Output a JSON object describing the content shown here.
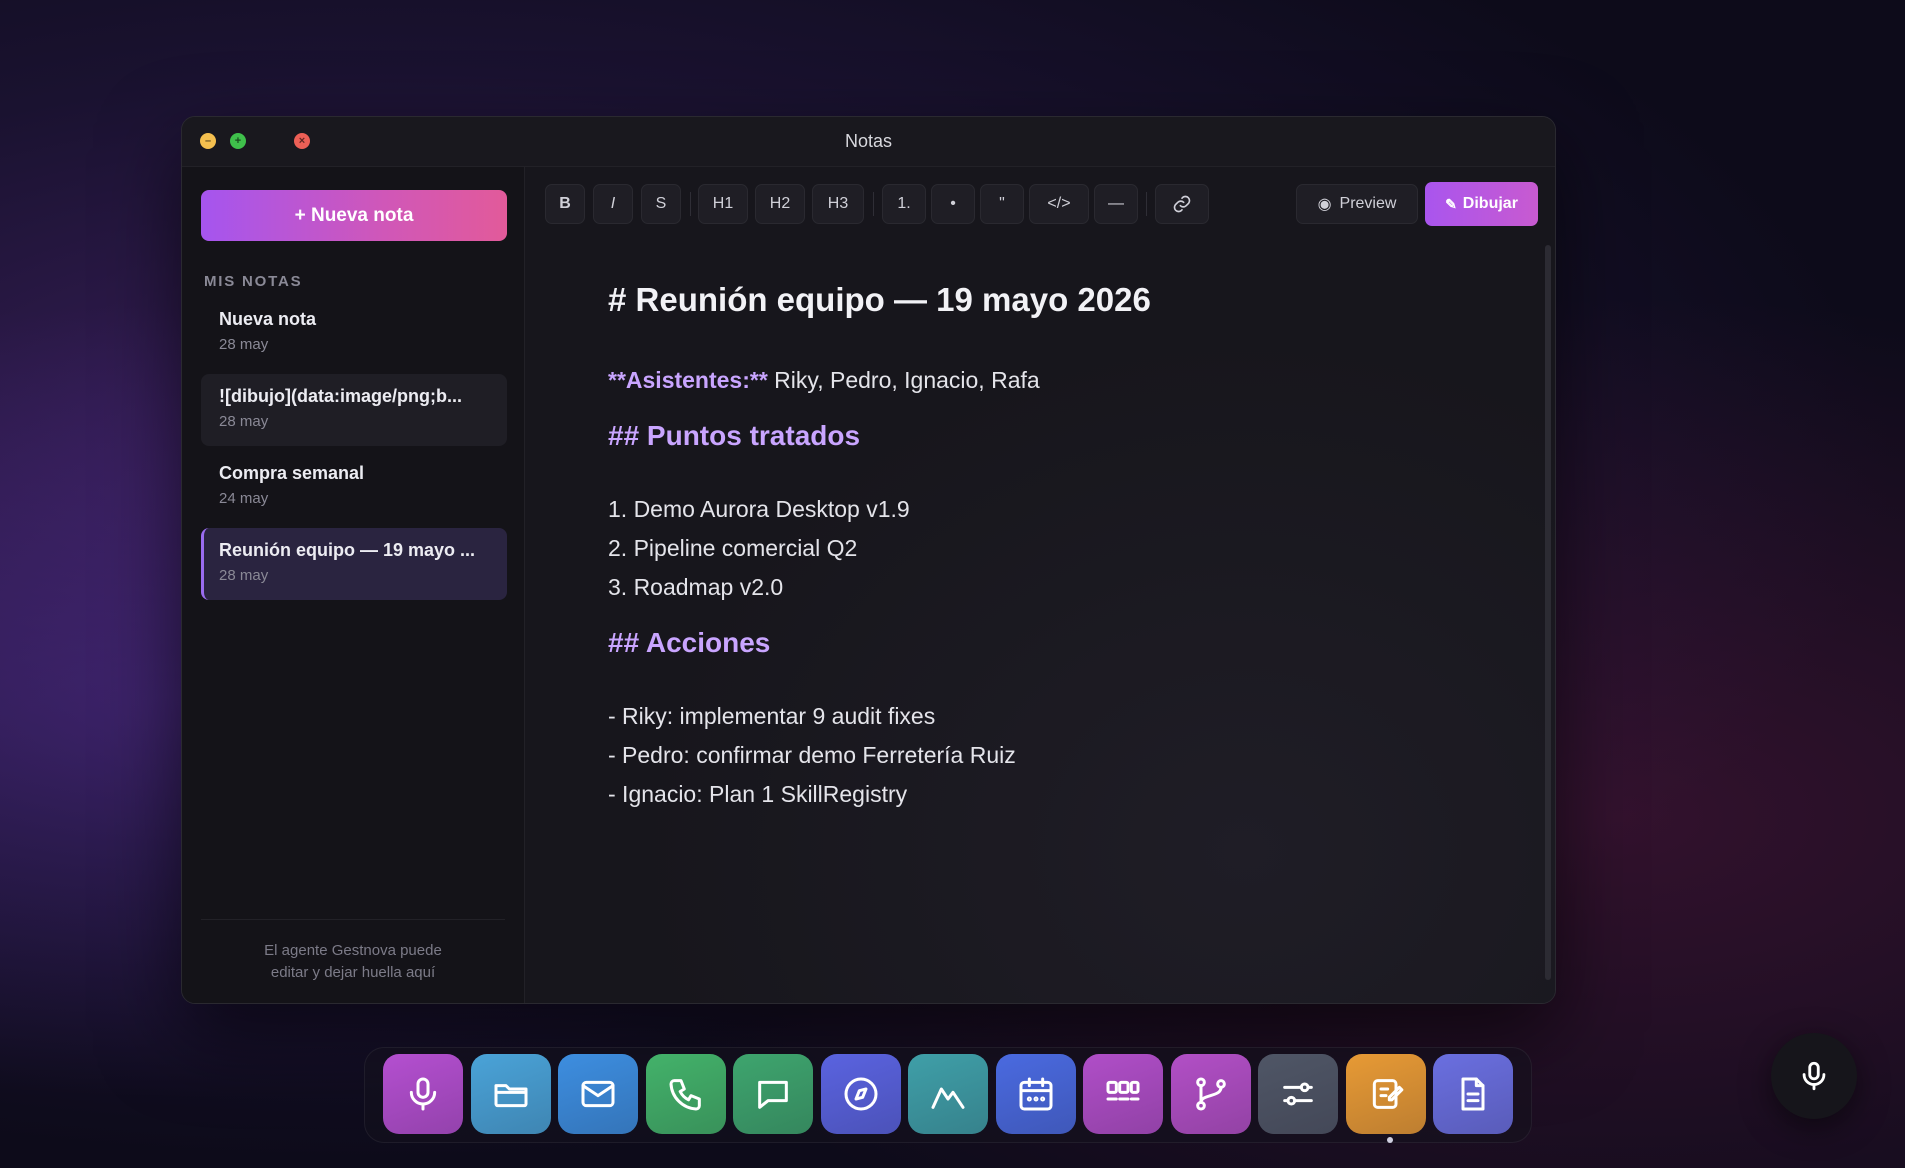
{
  "window": {
    "title": "Notas"
  },
  "sidebar": {
    "new_note_label": "+ Nueva nota",
    "section_label": "MIS NOTAS",
    "notes": [
      {
        "title": "Nueva nota",
        "date": "28 may"
      },
      {
        "title": "![dibujo](data:image/png;b...",
        "date": "28 may"
      },
      {
        "title": "Compra semanal",
        "date": "24 may"
      },
      {
        "title": "Reunión equipo — 19 mayo ...",
        "date": "28 may"
      }
    ],
    "footer_line1": "El agente Gestnova puede",
    "footer_line2": "editar y dejar huella aquí"
  },
  "toolbar": {
    "bold": "B",
    "italic": "I",
    "strike": "S",
    "h1": "H1",
    "h2": "H2",
    "h3": "H3",
    "ordered_list": "1.",
    "bullet_list": "•",
    "quote": "\"",
    "code": "</>",
    "hr": "—",
    "preview_label": "Preview",
    "draw_label": "Dibujar"
  },
  "editor": {
    "heading": "# Reunión equipo — 19 mayo 2026",
    "attendees_key": "**Asistentes:**",
    "attendees_value": " Riky, Pedro, Ignacio, Rafa",
    "section1": "## Puntos tratados",
    "items1": [
      "1. Demo Aurora Desktop v1.9",
      "2. Pipeline comercial Q2",
      "3. Roadmap v2.0"
    ],
    "section2": "## Acciones",
    "items2": [
      "- Riky: implementar 9 audit fixes",
      "- Pedro: confirmar demo Ferretería Ruiz",
      "- Ignacio: Plan 1 SkillRegistry"
    ]
  },
  "dock": {
    "apps": [
      {
        "icon": "microphone-icon",
        "color": "#b44fd0"
      },
      {
        "icon": "folder-icon",
        "color": "#4aa3d8"
      },
      {
        "icon": "mail-icon",
        "color": "#3d8ee0"
      },
      {
        "icon": "phone-icon",
        "color": "#43b26a"
      },
      {
        "icon": "chat-icon",
        "color": "#3ea56e"
      },
      {
        "icon": "compass-icon",
        "color": "#5a63e0"
      },
      {
        "icon": "chart-icon",
        "color": "#3f9fa8"
      },
      {
        "icon": "calendar-icon",
        "color": "#4a6ae0"
      },
      {
        "icon": "kanban-icon",
        "color": "#b04ec8"
      },
      {
        "icon": "git-branch-icon",
        "color": "#b24fc6"
      },
      {
        "icon": "settings-sliders-icon",
        "color": "#4f5666"
      },
      {
        "icon": "notes-icon",
        "color": "#e79a35"
      },
      {
        "icon": "document-icon",
        "color": "#6a6fe0"
      }
    ]
  }
}
